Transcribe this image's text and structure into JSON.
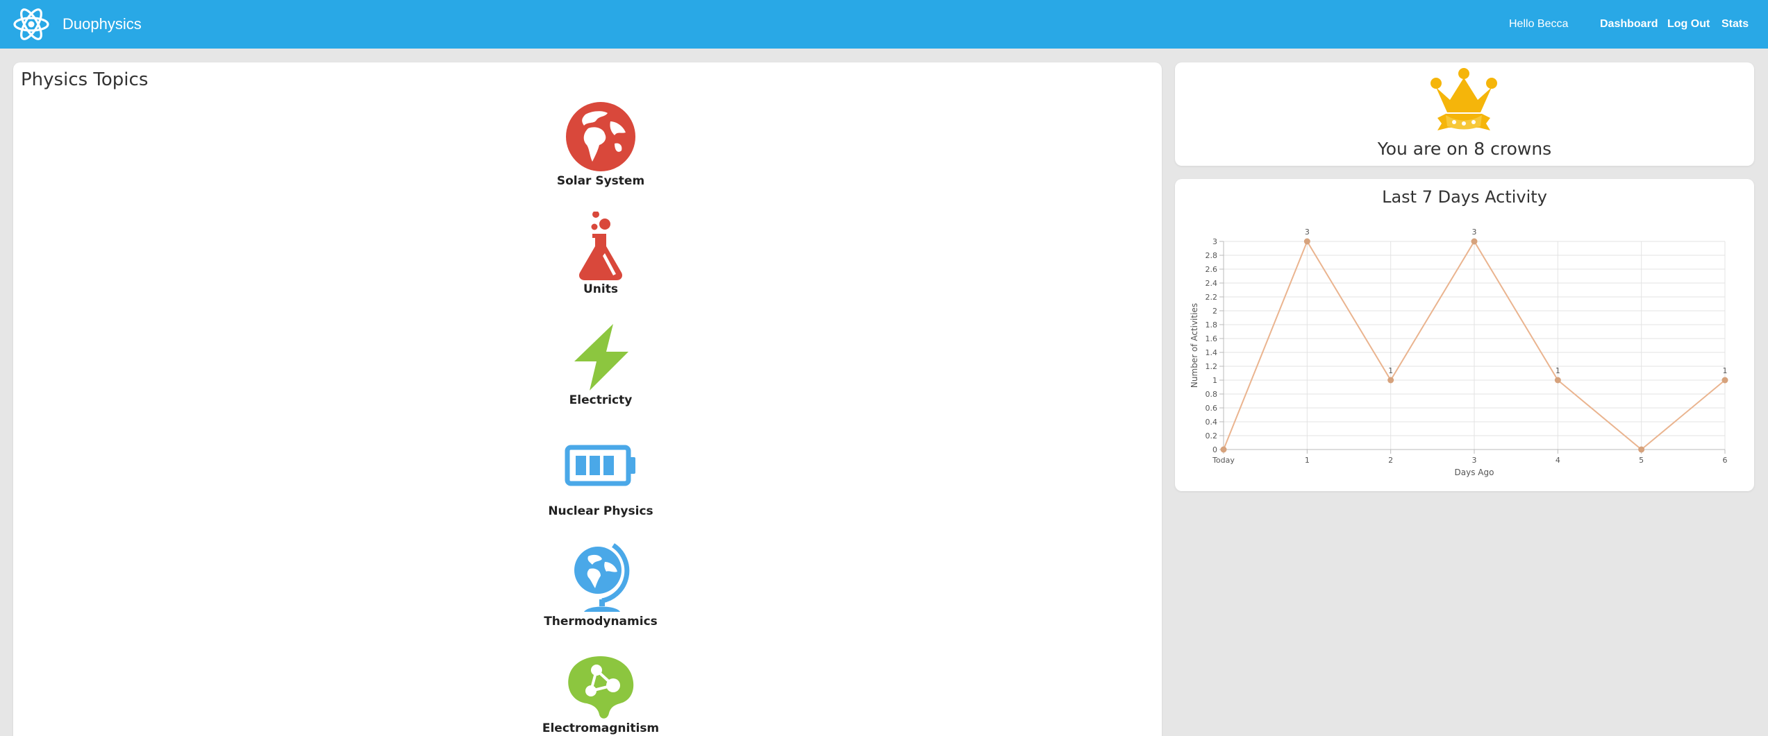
{
  "app": {
    "name": "Duophysics",
    "greeting": "Hello Becca",
    "nav": [
      {
        "label": "Dashboard"
      },
      {
        "label": "Log Out"
      },
      {
        "label": "Stats"
      }
    ]
  },
  "topics": {
    "title": "Physics Topics",
    "items": [
      {
        "label": "Solar System",
        "icon": "earth-globe-icon",
        "color": "#d9483b"
      },
      {
        "label": "Units",
        "icon": "flask-icon",
        "color": "#d9483b"
      },
      {
        "label": "Electricty",
        "icon": "lightning-bolt-icon",
        "color": "#8cc63f"
      },
      {
        "label": "Nuclear Physics",
        "icon": "battery-icon",
        "color": "#4aa8e8"
      },
      {
        "label": "Thermodynamics",
        "icon": "desk-globe-icon",
        "color": "#4aa8e8"
      },
      {
        "label": "Electromagnitism",
        "icon": "brain-icon",
        "color": "#8cc63f"
      }
    ]
  },
  "crowns": {
    "text": "You are on 8 crowns",
    "icon": "crown-icon",
    "color": "#f5b50a"
  },
  "chart": {
    "title": "Last 7 Days Activity"
  },
  "chart_data": {
    "type": "line",
    "title": "Last 7 Days Activity",
    "xlabel": "Days Ago",
    "ylabel": "Number of Activities",
    "categories": [
      "Today",
      "1",
      "2",
      "3",
      "4",
      "5",
      "6"
    ],
    "series": [
      {
        "values": [
          0,
          3,
          1,
          3,
          1,
          0,
          1
        ],
        "color": "#eab48f"
      }
    ],
    "ylim": [
      0,
      3
    ],
    "yticks": [
      "0",
      "0.2",
      "0.4",
      "0.6",
      "0.8",
      "1",
      "1.2",
      "1.4",
      "1.6",
      "1.8",
      "2",
      "2.2",
      "2.4",
      "2.6",
      "2.8",
      "3"
    ],
    "data_labels": [
      "",
      "3",
      "1",
      "3",
      "1",
      "",
      "1"
    ],
    "grid": true
  }
}
